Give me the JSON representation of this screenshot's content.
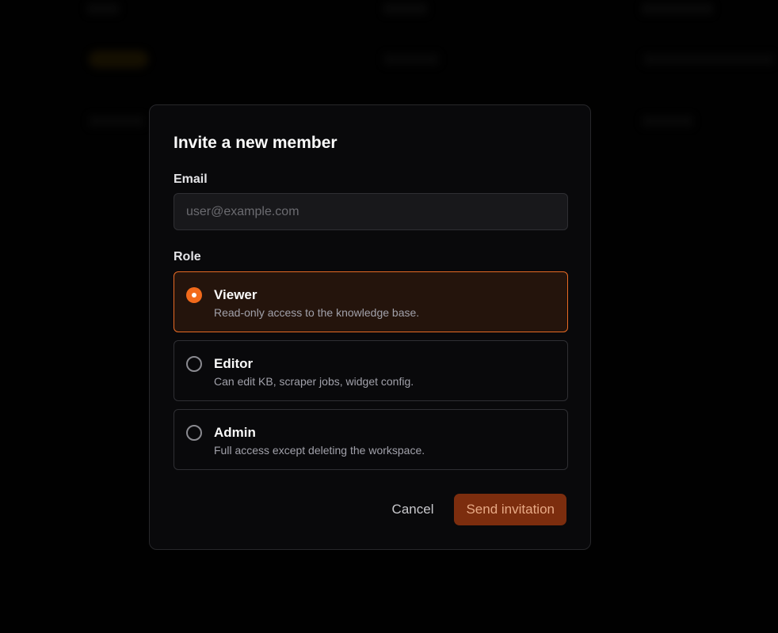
{
  "background": {
    "note_blurred": true
  },
  "modal": {
    "title": "Invite a new member",
    "email": {
      "label": "Email",
      "placeholder": "user@example.com",
      "value": ""
    },
    "role": {
      "label": "Role",
      "selected": "viewer",
      "options": [
        {
          "id": "viewer",
          "name": "Viewer",
          "description": "Read-only access to the knowledge base."
        },
        {
          "id": "editor",
          "name": "Editor",
          "description": "Can edit KB, scraper jobs, widget config."
        },
        {
          "id": "admin",
          "name": "Admin",
          "description": "Full access except deleting the workspace."
        }
      ]
    },
    "actions": {
      "cancel_label": "Cancel",
      "send_label": "Send invitation"
    }
  },
  "colors": {
    "accent": "#f26a1b",
    "selected_border": "#e86a24",
    "selected_bg": "#24140c",
    "send_button_bg": "#7c2d0e",
    "modal_bg": "#09090b"
  }
}
